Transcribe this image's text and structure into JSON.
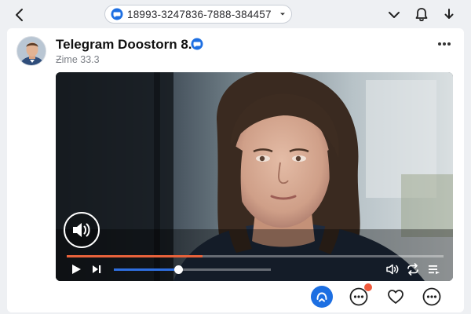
{
  "header": {
    "chat_id": "18993-3247836-7888-384457"
  },
  "post": {
    "channel_name": "Telegram Doostorn 8.0",
    "time": "Ƶime 33.3",
    "verified": true
  },
  "video": {
    "progress": 0.36,
    "volume": 0.41,
    "thumbnail": "woman-looking-at-screen"
  },
  "actions": {
    "comments_badge": true
  },
  "colors": {
    "accent": "#1d6fe2",
    "progress": "#e8623b",
    "volume": "#2f6fe0",
    "badge": "#f05a3c"
  },
  "icons": [
    "back-icon",
    "chat-bubble-icon",
    "caret-down-icon",
    "chevron-down-icon",
    "bell-icon",
    "download-icon",
    "more-icon",
    "verified-icon",
    "volume-icon",
    "play-icon",
    "skip-next-icon",
    "repeat-icon",
    "playlist-icon",
    "share-icon",
    "comment-icon",
    "heart-icon"
  ]
}
